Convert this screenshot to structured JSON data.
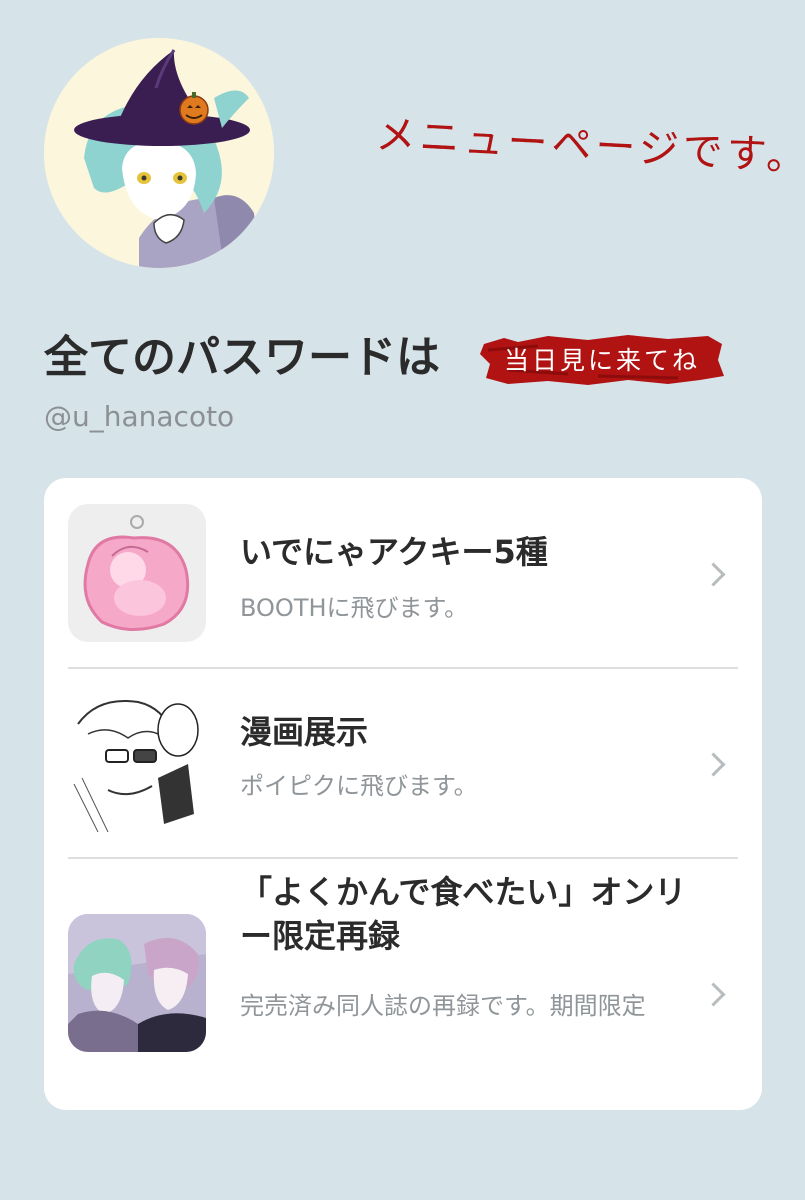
{
  "profile": {
    "title": "全てのパスワードは",
    "tag": "当日見に来てね",
    "note": "メニューページです。",
    "handle": "@u_hanacoto"
  },
  "links": [
    {
      "title": "いでにゃアクキー5種",
      "subtitle": "BOOTHに飛びます。",
      "thumb_icon": "acrylic-keychain-thumbnail"
    },
    {
      "title": "漫画展示",
      "subtitle": "ポイピクに飛びます。",
      "thumb_icon": "manga-page-thumbnail"
    },
    {
      "title": "「よくかんで食べたい」オンリー限定再録",
      "subtitle": "完売済み同人誌の再録です。期間限定",
      "thumb_icon": "comic-cover-thumbnail"
    }
  ],
  "colors": {
    "background": "#d6e4ea",
    "accent_red": "#b11212",
    "card": "#ffffff"
  }
}
